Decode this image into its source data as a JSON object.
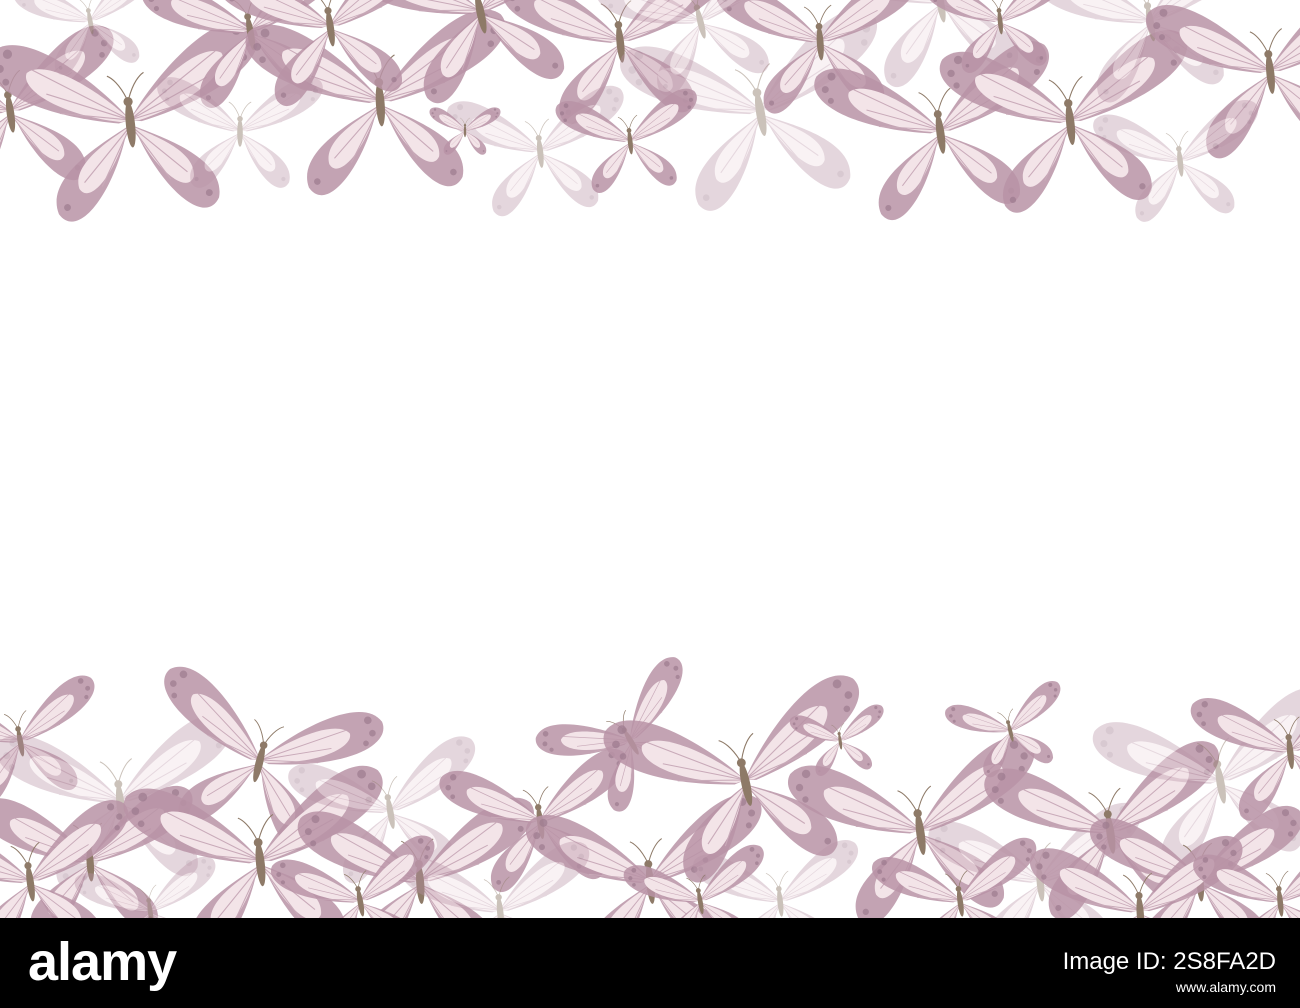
{
  "watermark": {
    "brand": "alamy",
    "image_id": "Image ID: 2S8FA2D",
    "url": "www.alamy.com"
  },
  "palette": {
    "background": "#ffffff",
    "wing_fill": "#f3e4e8",
    "wing_border": "#b893a6",
    "wing_spot": "#9d7a8e",
    "vein": "#c9aab9",
    "body": "#8e7a68",
    "faded_opacity": "0.45",
    "bar": "#000000",
    "bar_text": "#ffffff"
  },
  "scene": {
    "description_icon": "butterfly-icon",
    "border_top_count": 22,
    "border_bottom_count": 28
  }
}
